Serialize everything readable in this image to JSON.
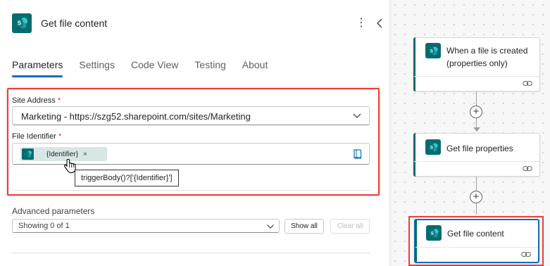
{
  "panel": {
    "title": "Get file content",
    "more_glyph": "⋮",
    "tabs": [
      "Parameters",
      "Settings",
      "Code View",
      "Testing",
      "About"
    ],
    "active_tab": "Parameters"
  },
  "site_address": {
    "label": "Site Address",
    "required_mark": "*",
    "value": "Marketing - https://szg52.sharepoint.com/sites/Marketing"
  },
  "file_identifier": {
    "label": "File Identifier",
    "required_mark": "*",
    "token_text": "{Identifier}",
    "token_remove": "×",
    "tooltip": "triggerBody()?['{Identifier}']"
  },
  "advanced": {
    "label": "Advanced parameters",
    "select_value": "Showing 0 of 1",
    "show_all": "Show all",
    "clear_all": "Clear all"
  },
  "flow": {
    "steps": [
      {
        "title": "When a file is created (properties only)"
      },
      {
        "title": "Get file properties"
      },
      {
        "title": "Get file content"
      }
    ],
    "plus_glyph": "+"
  },
  "colors": {
    "sharepoint": "#036c70",
    "accent": "#0f6cbd",
    "highlight": "#e3403c"
  },
  "icons": {
    "app": "sharepoint-icon",
    "more": "more-vertical-icon",
    "collapse": "chevron-left-icon",
    "dropdown": "chevron-down-icon",
    "dynamic_content": "book-icon",
    "pointer": "hand-cursor-icon",
    "link": "link-icon",
    "add": "plus-icon"
  }
}
